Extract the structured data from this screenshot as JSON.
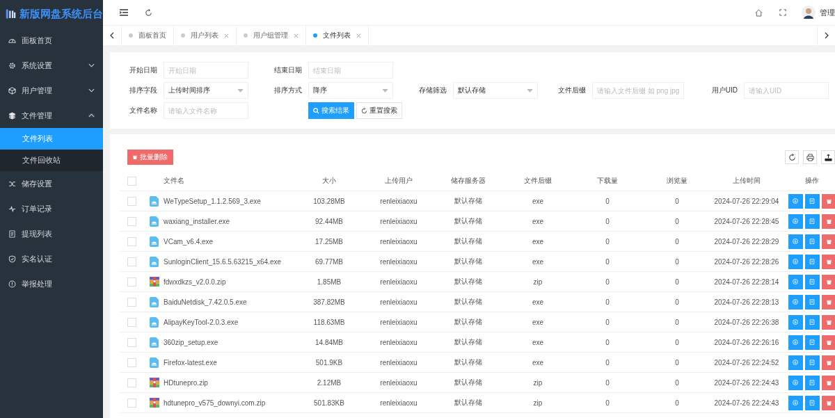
{
  "brand": {
    "title": "新版网盘系统后台"
  },
  "sidebar": {
    "items": [
      {
        "label": "面板首页",
        "kind": "link",
        "selected": false
      },
      {
        "label": "系统设置",
        "kind": "group",
        "expanded": false,
        "selected": false
      },
      {
        "label": "用户管理",
        "kind": "group",
        "expanded": false,
        "selected": false
      },
      {
        "label": "文件管理",
        "kind": "group",
        "expanded": true,
        "selected": false,
        "children": [
          {
            "label": "文件列表",
            "selected": true
          },
          {
            "label": "文件回收站",
            "selected": false
          }
        ]
      },
      {
        "label": "储存设置",
        "kind": "link",
        "selected": false
      },
      {
        "label": "订单记录",
        "kind": "link",
        "selected": false
      },
      {
        "label": "提现列表",
        "kind": "link",
        "selected": false
      },
      {
        "label": "实名认证",
        "kind": "link",
        "selected": false
      },
      {
        "label": "举报处理",
        "kind": "link",
        "selected": false
      }
    ]
  },
  "header": {
    "user": "管理"
  },
  "tabs": [
    {
      "label": "面板首页",
      "closable": false,
      "selected": false
    },
    {
      "label": "用户列表",
      "closable": true,
      "selected": false
    },
    {
      "label": "用户组管理",
      "closable": true,
      "selected": false
    },
    {
      "label": "文件列表",
      "closable": true,
      "selected": true
    }
  ],
  "filters": {
    "rows": [
      [
        {
          "label": "开始日期",
          "kind": "input",
          "placeholder": "开始日期"
        },
        {
          "label": "结束日期",
          "kind": "input",
          "placeholder": "结束日期"
        }
      ],
      [
        {
          "label": "排序字段",
          "kind": "select",
          "value": "上传时间排序"
        },
        {
          "label": "排序方式",
          "kind": "select",
          "value": "降序"
        },
        {
          "label": "存储筛选",
          "kind": "select",
          "value": "默认存储"
        },
        {
          "label": "文件后缀",
          "kind": "input",
          "placeholder": "请输入文件后缀 如 png jpg"
        },
        {
          "label": "用户UID",
          "kind": "input",
          "placeholder": "请输入UID"
        }
      ],
      [
        {
          "label": "文件名称",
          "kind": "input",
          "placeholder": "请输入文件名称"
        }
      ]
    ],
    "search_button": "搜索结果",
    "reset_button": "重置搜索"
  },
  "table": {
    "batch_delete": "批量删除",
    "select_all_checked": false,
    "columns": [
      "文件名",
      "大小",
      "上传用户",
      "储存服务器",
      "文件后缀",
      "下载量",
      "浏览量",
      "上传时间",
      "操作"
    ],
    "rows": [
      {
        "kind": "exe",
        "checked": false,
        "name": "WeTypeSetup_1.1.2.569_3.exe",
        "size": "103.28MB",
        "user": "renleixiaoxu",
        "storage": "默认存储",
        "ext": "exe",
        "downloads": "0",
        "views": "0",
        "time": "2024-07-26 22:29:04"
      },
      {
        "kind": "exe",
        "checked": false,
        "name": "waxiang_installer.exe",
        "size": "92.44MB",
        "user": "renleixiaoxu",
        "storage": "默认存储",
        "ext": "exe",
        "downloads": "0",
        "views": "0",
        "time": "2024-07-26 22:28:45"
      },
      {
        "kind": "exe",
        "checked": false,
        "name": "VCam_v6.4.exe",
        "size": "17.25MB",
        "user": "renleixiaoxu",
        "storage": "默认存储",
        "ext": "exe",
        "downloads": "0",
        "views": "0",
        "time": "2024-07-26 22:28:29"
      },
      {
        "kind": "exe",
        "checked": false,
        "name": "SunloginClient_15.6.5.63215_x64.exe",
        "size": "69.77MB",
        "user": "renleixiaoxu",
        "storage": "默认存储",
        "ext": "exe",
        "downloads": "0",
        "views": "0",
        "time": "2024-07-26 22:28:26"
      },
      {
        "kind": "zip",
        "checked": false,
        "name": "fdwxdkzs_v2.0.0.zip",
        "size": "1.85MB",
        "user": "renleixiaoxu",
        "storage": "默认存储",
        "ext": "zip",
        "downloads": "0",
        "views": "0",
        "time": "2024-07-26 22:28:14"
      },
      {
        "kind": "exe",
        "checked": false,
        "name": "BaiduNetdisk_7.42.0.5.exe",
        "size": "387.82MB",
        "user": "renleixiaoxu",
        "storage": "默认存储",
        "ext": "exe",
        "downloads": "0",
        "views": "0",
        "time": "2024-07-26 22:28:13"
      },
      {
        "kind": "exe",
        "checked": false,
        "name": "AlipayKeyTool-2.0.3.exe",
        "size": "118.63MB",
        "user": "renleixiaoxu",
        "storage": "默认存储",
        "ext": "exe",
        "downloads": "0",
        "views": "0",
        "time": "2024-07-26 22:26:38"
      },
      {
        "kind": "exe",
        "checked": false,
        "name": "360zip_setup.exe",
        "size": "14.84MB",
        "user": "renleixiaoxu",
        "storage": "默认存储",
        "ext": "exe",
        "downloads": "0",
        "views": "0",
        "time": "2024-07-26 22:26:16"
      },
      {
        "kind": "exe",
        "checked": false,
        "name": "Firefox-latest.exe",
        "size": "501.9KB",
        "user": "renleixiaoxu",
        "storage": "默认存储",
        "ext": "exe",
        "downloads": "0",
        "views": "0",
        "time": "2024-07-26 22:24:52"
      },
      {
        "kind": "zip",
        "checked": false,
        "name": "HDtunepro.zip",
        "size": "2.12MB",
        "user": "renleixiaoxu",
        "storage": "默认存储",
        "ext": "zip",
        "downloads": "0",
        "views": "0",
        "time": "2024-07-26 22:24:43"
      },
      {
        "kind": "zip",
        "checked": false,
        "name": "hdtunepro_v575_downyi.com.zip",
        "size": "501.83KB",
        "user": "renleixiaoxu",
        "storage": "默认存储",
        "ext": "zip",
        "downloads": "0",
        "views": "0",
        "time": "2024-07-26 22:24:43"
      }
    ]
  }
}
